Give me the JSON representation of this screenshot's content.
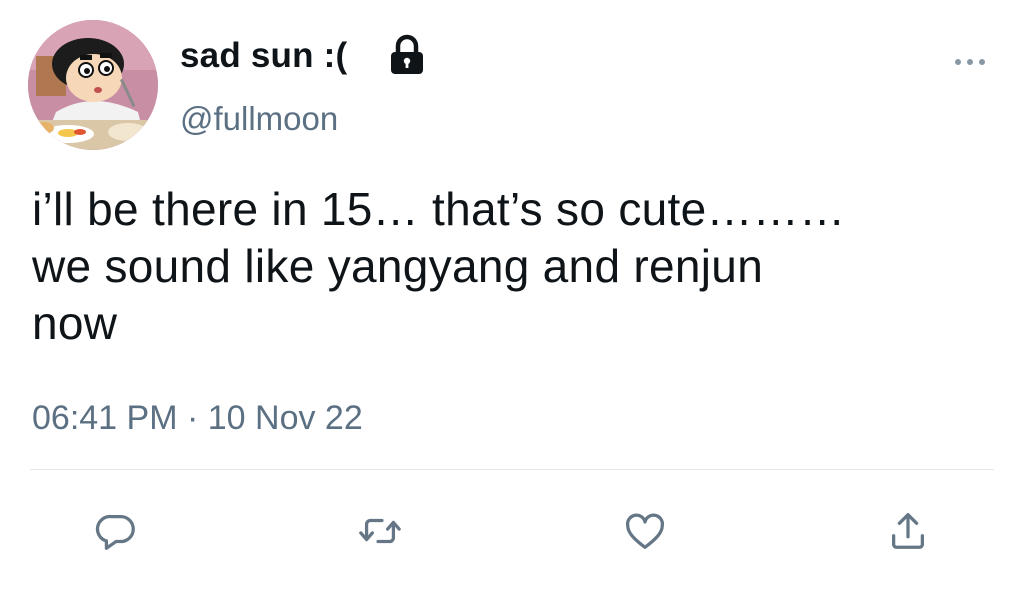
{
  "tweet": {
    "display_name": "sad sun :(",
    "handle": "@fullmoon",
    "text_lines": [
      "i’ll be there in 15… that’s so cute………",
      "we sound like yangyang and renjun",
      "now"
    ],
    "timestamp": "06:41 PM · 10 Nov 22"
  },
  "icons": {
    "avatar": "cartoon-avatar",
    "lock": "lock-icon",
    "more": "more-icon",
    "reply": "reply-icon",
    "retweet": "retweet-icon",
    "like": "heart-icon",
    "share": "share-icon"
  },
  "colors": {
    "text": "#0f1419",
    "secondary": "#5b7083",
    "icon": "#657786",
    "divider": "#e3e7ea"
  }
}
